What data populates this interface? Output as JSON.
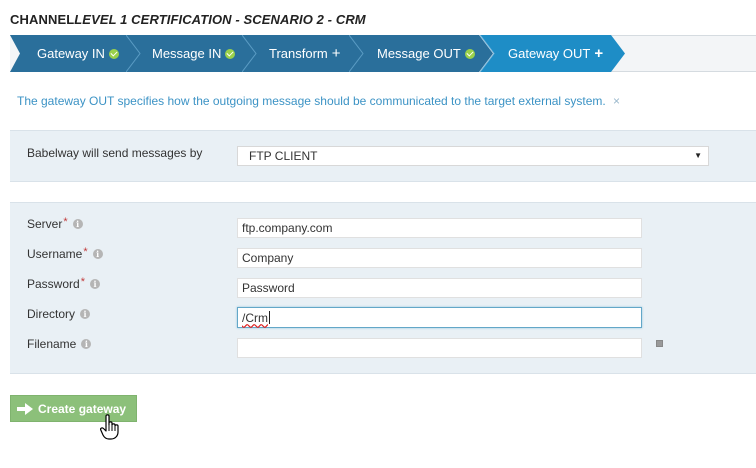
{
  "title": {
    "prefix": "CHANNEL",
    "main": "LEVEL 1 CERTIFICATION - SCENARIO 2 - CRM"
  },
  "steps": [
    {
      "label": "Gateway IN",
      "state": "done"
    },
    {
      "label": "Message IN",
      "state": "done"
    },
    {
      "label": "Transform",
      "state": "add"
    },
    {
      "label": "Message OUT",
      "state": "done"
    },
    {
      "label": "Gateway OUT",
      "state": "active"
    }
  ],
  "step_icons": {
    "done": "✔",
    "add": "+"
  },
  "info_message": "The gateway OUT specifies how the outgoing message should be communicated to the target external system.",
  "info_close": "×",
  "send_by": {
    "label": "Babelway will send messages by",
    "selected": "FTP CLIENT"
  },
  "fields": {
    "server": {
      "label": "Server",
      "value": "ftp.company.com",
      "required": true
    },
    "username": {
      "label": "Username",
      "value": "Company",
      "required": true
    },
    "password": {
      "label": "Password",
      "value": "Password",
      "required": true
    },
    "directory": {
      "label": "Directory",
      "value": "/Crm",
      "required": false
    },
    "filename": {
      "label": "Filename",
      "value": "",
      "required": false
    }
  },
  "required_marker": "*",
  "create_button": "Create gateway",
  "colors": {
    "step_blue": "#1f82b5",
    "step_done_blue": "#2a6f9b",
    "step_active": "#1e8dc6",
    "accent_green": "#8cc07a",
    "check_green": "#9ad14b",
    "info_text": "#3c93c5",
    "panel_bg": "#e9f0f5"
  }
}
